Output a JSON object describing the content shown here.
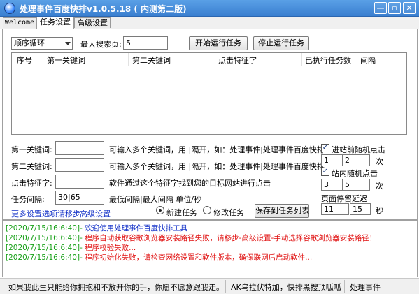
{
  "window": {
    "title": "处理事件百度快排v1.0.5.18 ( 内测第二版)",
    "buttons": {
      "minimize": "—",
      "restore": "▫",
      "close": "✕"
    }
  },
  "tabs": [
    {
      "label": "Welcome"
    },
    {
      "label": "任务设置"
    },
    {
      "label": "高级设置"
    }
  ],
  "task": {
    "mode_value": "顺序循环",
    "max_pages_label": "最大搜索页:",
    "max_pages_value": "5",
    "start_button": "开始运行任务",
    "stop_button": "停止运行任务"
  },
  "table": {
    "columns": [
      "序号",
      "第一关键词",
      "第二关键词",
      "点击特征字",
      "已执行任务数",
      "间隔"
    ],
    "rows": []
  },
  "form": {
    "kw1_label": "第一关键词:",
    "kw1_value": "",
    "kw1_hint": "可输入多个关键词，用 |隔开，如：处理事件|处理事件百度快排",
    "kw2_label": "第二关键词:",
    "kw2_value": "",
    "kw2_hint": "可输入多个关键词，用 |隔开，如：处理事件|处理事件百度快排",
    "feature_label": "点击特征字:",
    "feature_value": "",
    "feature_hint": "软件通过这个特征字找到您的目标网站进行点击",
    "interval_label": "任务间隔:",
    "interval_value": "30|65",
    "interval_hint": "最低间隔|最大间隔  单位/秒",
    "more_settings_link": "更多设置选项请移步",
    "advanced_link": "高级设置",
    "radio_new": "新建任务",
    "radio_edit": "修改任务",
    "save_button": "保存到任务列表"
  },
  "random": {
    "pre_click_label": "进站前随机点击",
    "pre_min": "1",
    "pre_dash": "—",
    "pre_max": "2",
    "pre_unit": "次",
    "in_click_label": "站内随机点击",
    "in_min": "3",
    "in_dash": "—",
    "in_max": "5",
    "in_unit": "次",
    "stay_label": "页面停留延迟",
    "stay_min": "11",
    "stay_dash": "—",
    "stay_max": "15",
    "stay_unit": "秒"
  },
  "log": [
    {
      "ts": "[2020/7/15/16:6:40]-",
      "msg": "欢迎使用处理事件百度快排工具",
      "color": "#1533c8"
    },
    {
      "ts": "[2020/7/15/16:6:40]-",
      "msg": "程序自动获取谷歌浏览器安装路径失败，请移步-高级设置-手动选择谷歌浏览器安装路径！",
      "color": "#e01010"
    },
    {
      "ts": "[2020/7/15/16:6:40]-",
      "msg": "程序校验失败...",
      "color": "#e01010"
    },
    {
      "ts": "[2020/7/15/16:6:40]-",
      "msg": "程序初始化失败，请检查网络设置和软件版本，确保联网后启动软件...",
      "color": "#e01010"
    }
  ],
  "status": {
    "left_text": "如果我此生只能给你拥抱和不放开你的手，你愿不愿意跟我走。",
    "mid_text": "AK乌拉伏特加，快排黑搜顶呱呱",
    "right_text": "处理事件"
  }
}
